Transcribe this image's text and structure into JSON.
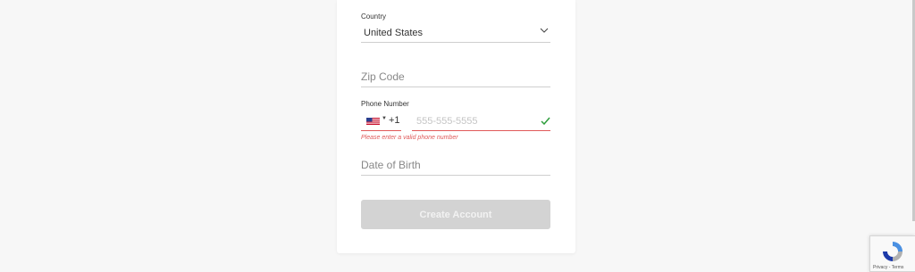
{
  "form": {
    "country": {
      "label": "Country",
      "value": "United States"
    },
    "zip": {
      "placeholder": "Zip Code"
    },
    "phone": {
      "label": "Phone Number",
      "dial_code": "+1",
      "placeholder": "555-555-5555",
      "error": "Please enter a valid phone number"
    },
    "dob": {
      "placeholder": "Date of Birth"
    },
    "submit_label": "Create Account"
  },
  "recaptcha": {
    "links": "Privacy - Terms"
  },
  "colors": {
    "error": "#e05a5a",
    "valid": "#2e9e3c",
    "button_disabled": "#d3d3d3"
  }
}
